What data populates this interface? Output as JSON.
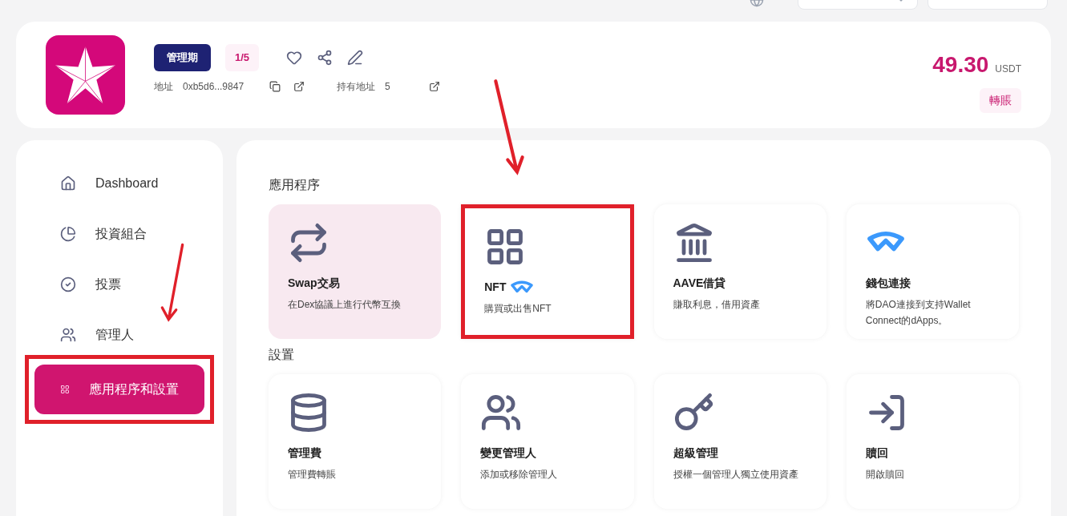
{
  "header": {
    "status_badge": "管理期",
    "member_badge": "1/5",
    "address_label": "地址",
    "address": "0xb5d6...9847",
    "holders_label": "持有地址",
    "holders": "5",
    "balance": "49.30",
    "currency": "USDT",
    "transfer_button": "轉賬"
  },
  "sidebar": {
    "items": [
      {
        "label": "Dashboard",
        "selected": false,
        "annotated": false
      },
      {
        "label": "投資組合",
        "selected": false,
        "annotated": false
      },
      {
        "label": "投票",
        "selected": false,
        "annotated": false
      },
      {
        "label": "管理人",
        "selected": false,
        "annotated": false
      },
      {
        "label": "應用程序和設置",
        "selected": true,
        "annotated": true
      }
    ]
  },
  "sections": [
    {
      "title": "應用程序",
      "cards": [
        {
          "title": "Swap交易",
          "description": "在Dex協議上進行代幣互換",
          "selected": true,
          "annotated": false
        },
        {
          "title": "NFT",
          "description": "購買或出售NFT",
          "selected": false,
          "annotated": true
        },
        {
          "title": "AAVE借貸",
          "description": "賺取利息，借用資產",
          "selected": false,
          "annotated": false
        },
        {
          "title": "錢包連接",
          "description": "將DAO連接到支持Wallet Connect的dApps。",
          "selected": false,
          "annotated": false
        }
      ]
    },
    {
      "title": "設置",
      "cards": [
        {
          "title": "管理費",
          "description": "管理費轉賬",
          "selected": false,
          "annotated": false
        },
        {
          "title": "變更管理人",
          "description": "添加或移除管理人",
          "selected": false,
          "annotated": false
        },
        {
          "title": "超級管理",
          "description": "授權一個管理人獨立使用資產",
          "selected": false,
          "annotated": false
        },
        {
          "title": "贖回",
          "description": "開啟贖回",
          "selected": false,
          "annotated": false
        }
      ]
    }
  ]
}
